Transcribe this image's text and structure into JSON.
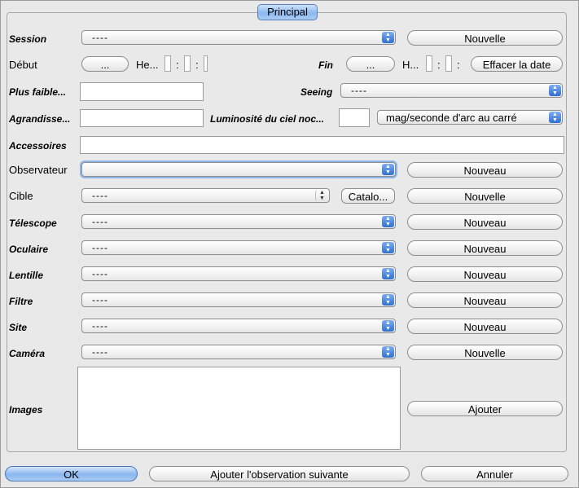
{
  "tab": {
    "label": "Principal"
  },
  "session": {
    "label": "Session",
    "value": "----",
    "button": "Nouvelle"
  },
  "debut": {
    "label": "Début",
    "date_button": "...",
    "hour_label": "He...",
    "sep": ":"
  },
  "fin": {
    "label": "Fin",
    "date_button": "...",
    "hour_label": "H...",
    "sep": ":",
    "clear_button": "Effacer la date"
  },
  "plus_faible": {
    "label": "Plus faible..."
  },
  "seeing": {
    "label": "Seeing",
    "value": "----"
  },
  "agrandissement": {
    "label": "Agrandisse..."
  },
  "luminosite": {
    "label": "Luminosité du ciel noc...",
    "unit": "mag/seconde d'arc au carré"
  },
  "accessoires": {
    "label": "Accessoires"
  },
  "observateur": {
    "label": "Observateur",
    "value": "",
    "button": "Nouveau"
  },
  "cible": {
    "label": "Cible",
    "value": "----",
    "catalog_button": "Catalo...",
    "button": "Nouvelle"
  },
  "telescope": {
    "label": "Télescope",
    "value": "----",
    "button": "Nouveau"
  },
  "oculaire": {
    "label": "Oculaire",
    "value": "----",
    "button": "Nouveau"
  },
  "lentille": {
    "label": "Lentille",
    "value": "----",
    "button": "Nouveau"
  },
  "filtre": {
    "label": "Filtre",
    "value": "----",
    "button": "Nouveau"
  },
  "site": {
    "label": "Site",
    "value": "----",
    "button": "Nouveau"
  },
  "camera": {
    "label": "Caméra",
    "value": "----",
    "button": "Nouvelle"
  },
  "images": {
    "label": "Images",
    "button": "Ajouter"
  },
  "footer": {
    "ok": "OK",
    "next": "Ajouter l'observation suivante",
    "cancel": "Annuler"
  },
  "icons": {
    "combo_arrow": "up-down-arrows-icon"
  }
}
